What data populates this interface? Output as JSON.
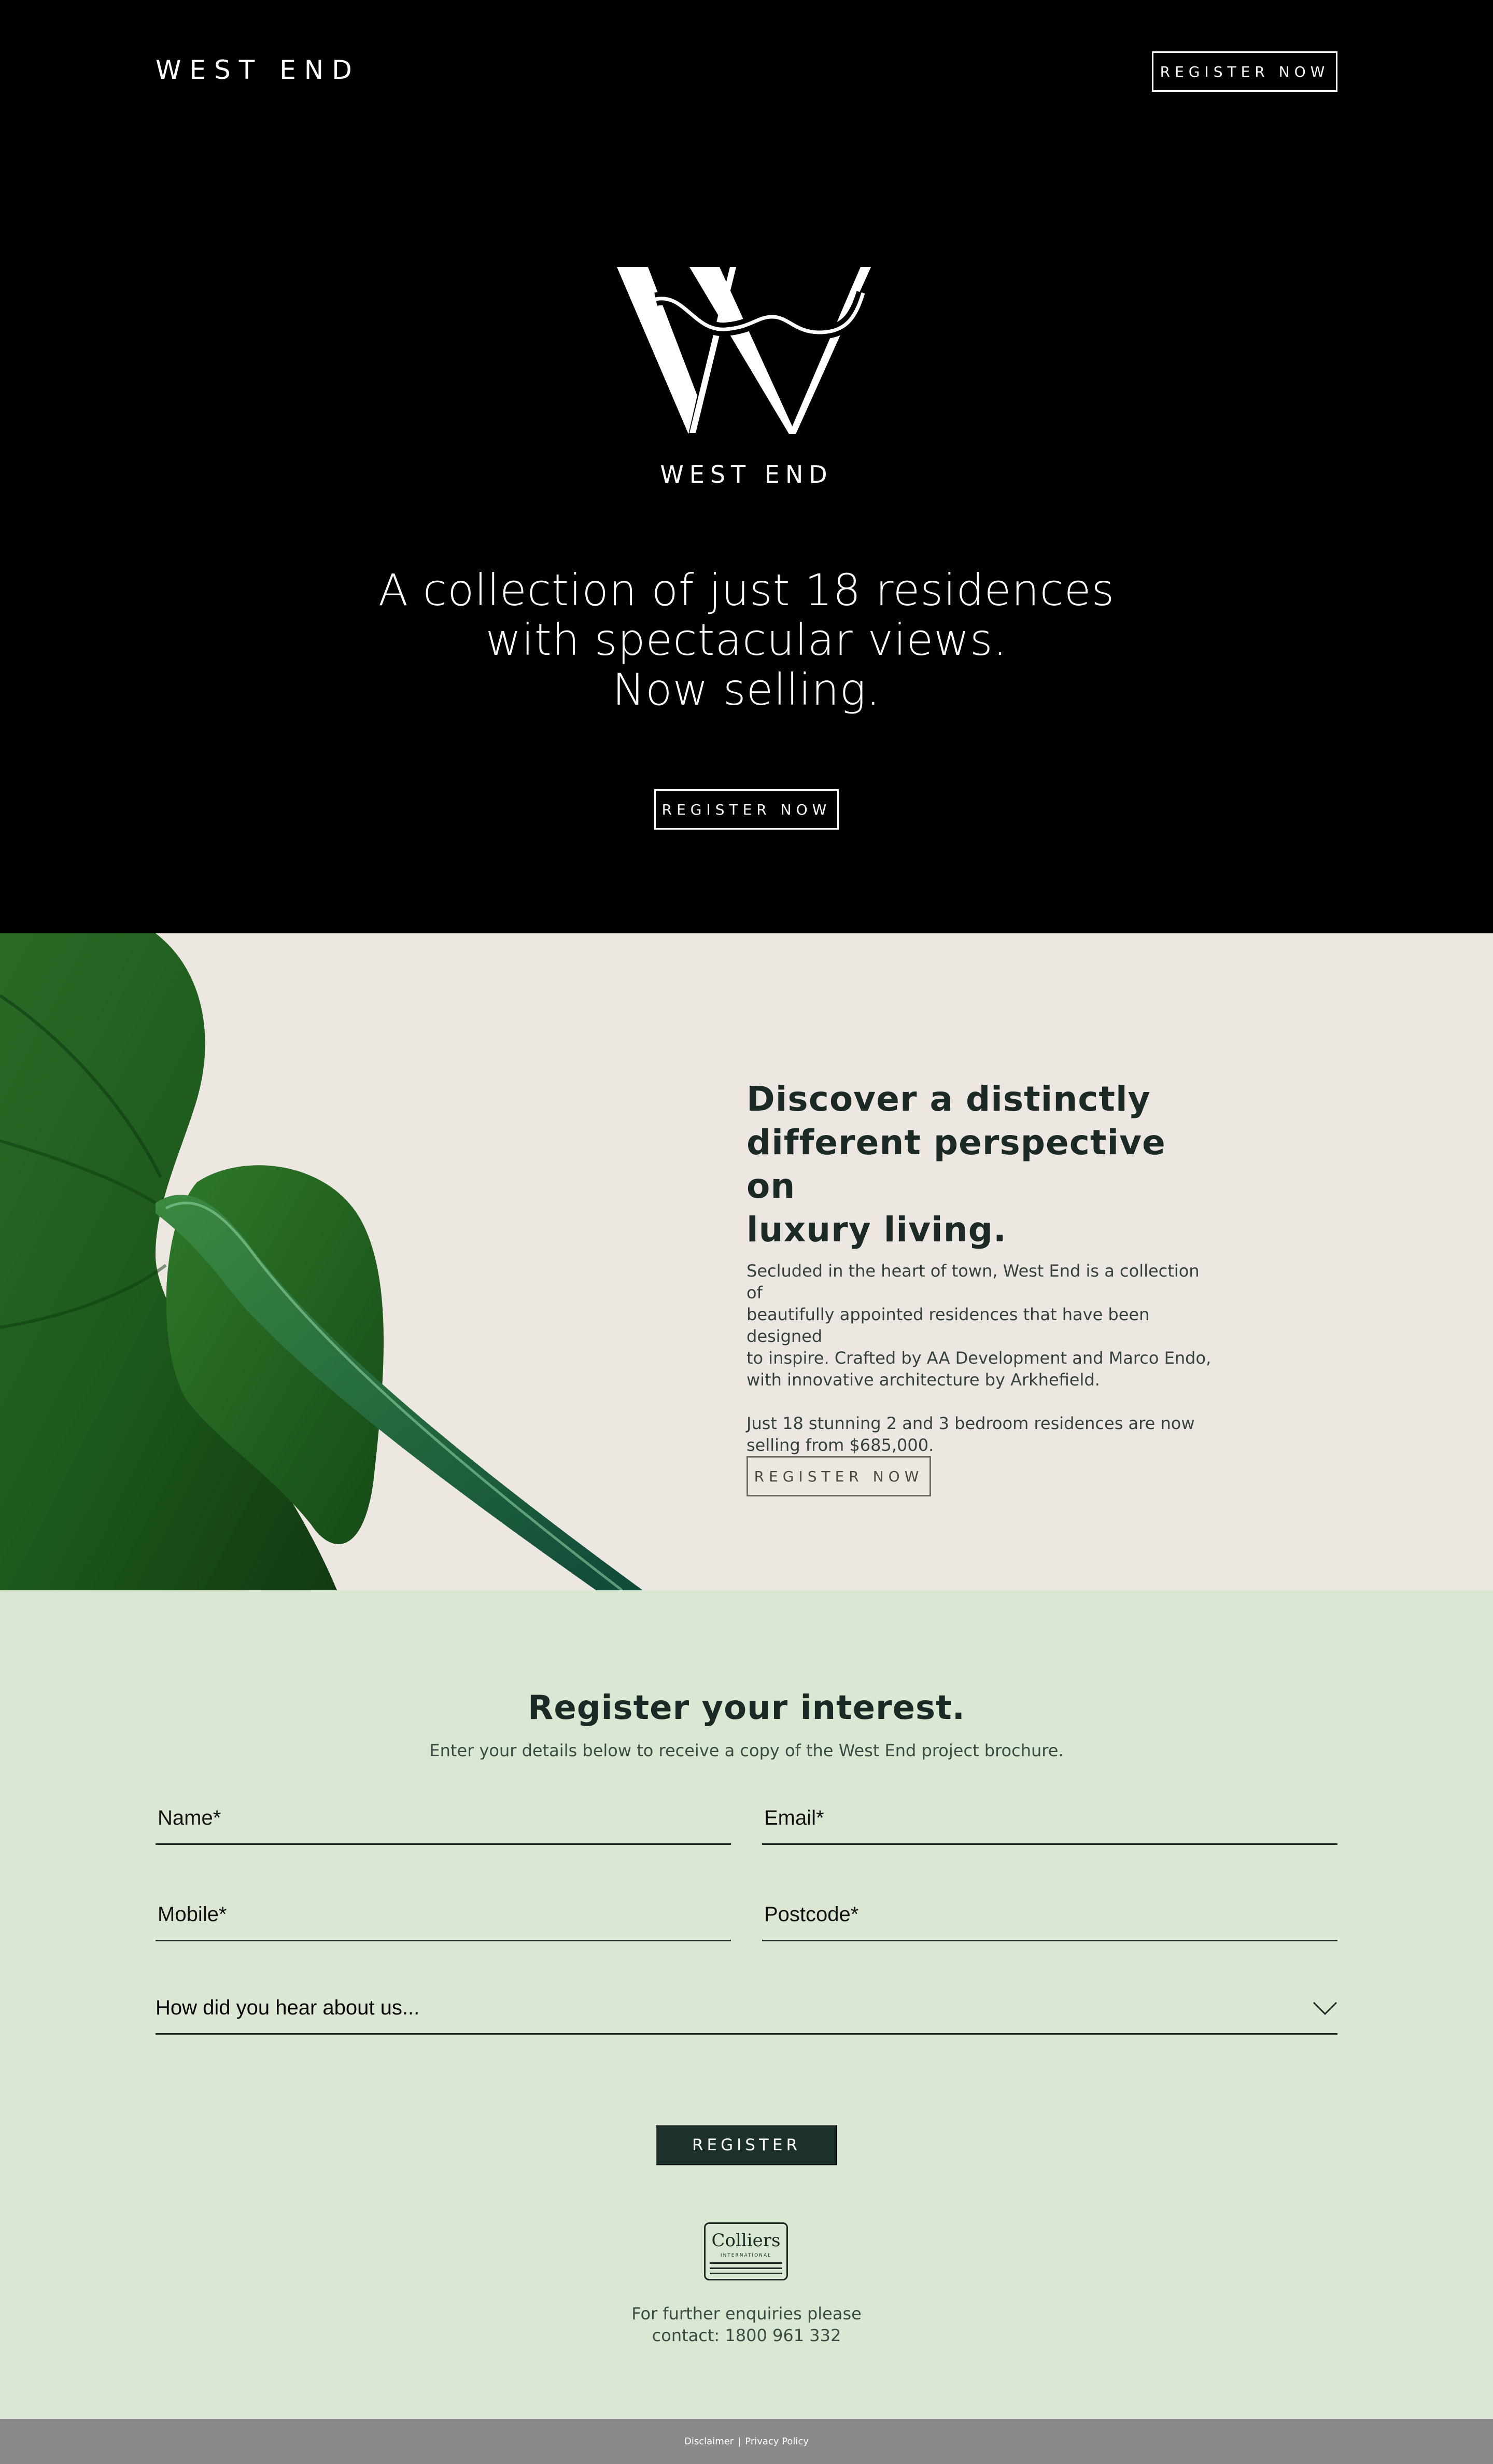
{
  "header": {
    "brand": "WEST END",
    "register_label": "REGISTER NOW"
  },
  "hero": {
    "logo_word": "WEST END",
    "headline_lines": [
      "A collection of just 18 residences",
      "with spectacular views.",
      "Now selling."
    ],
    "register_label": "REGISTER NOW"
  },
  "feature": {
    "title_lines": [
      "Discover a distinctly",
      "different perspective on",
      "luxury living."
    ],
    "paragraph1_lines": [
      "Secluded in the heart of town, West End is a collection of",
      "beautifully appointed residences that have been designed",
      "to inspire. Crafted by AA Development and Marco Endo,",
      "with innovative architecture by Arkhefield."
    ],
    "paragraph2_lines": [
      "Just 18 stunning 2 and 3 bedroom residences are now",
      "selling from $685,000."
    ],
    "register_label": "REGISTER NOW"
  },
  "register": {
    "title": "Register your interest.",
    "subtitle": "Enter your details below to receive a copy of the West End project brochure.",
    "fields": {
      "name_placeholder": "Name*",
      "email_placeholder": "Email*",
      "mobile_placeholder": "Mobile*",
      "postcode_placeholder": "Postcode*",
      "source_selected": "How did you hear about us..."
    },
    "submit_label": "REGISTER",
    "agency": {
      "name": "Colliers",
      "sub": "INTERNATIONAL"
    },
    "enquiry_lines": [
      "For further enquiries please",
      "contact: 1800 961 332"
    ]
  },
  "footer": {
    "disclaimer": "Disclaimer",
    "separator": "|",
    "privacy": "Privacy Policy"
  },
  "colors": {
    "hero_bg": "#000000",
    "feature_bg": "#ece8e1",
    "register_bg": "#dae8d3",
    "button_dark": "#1c302c",
    "footer_bg": "#8a8a8a"
  }
}
